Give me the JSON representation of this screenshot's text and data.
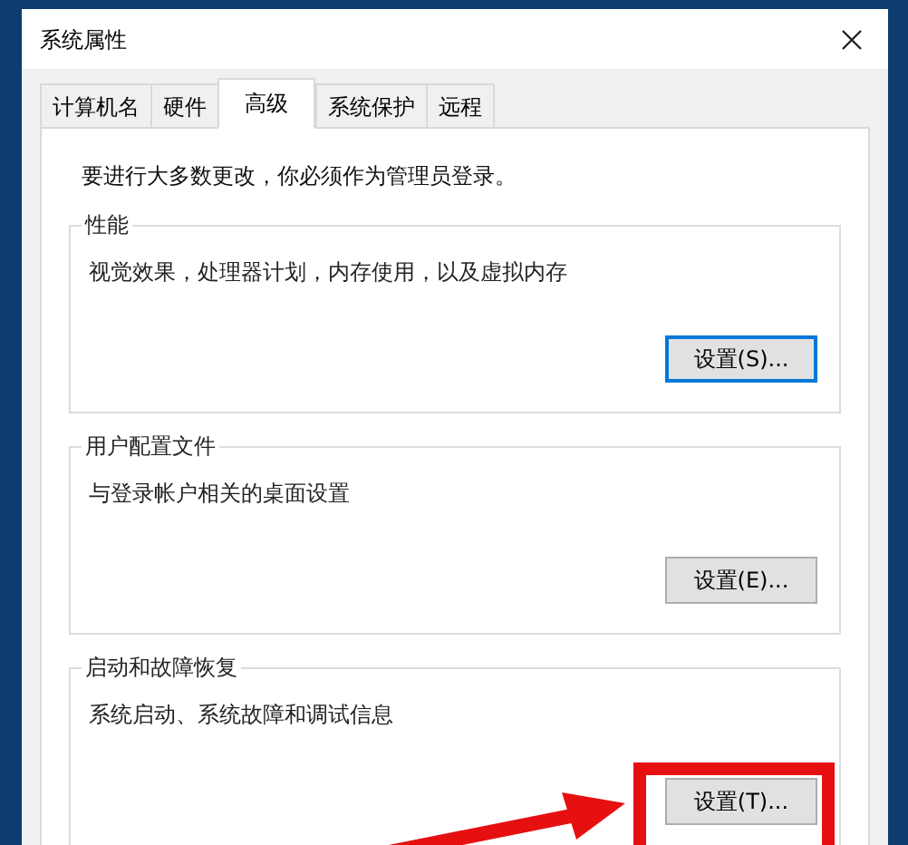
{
  "window": {
    "title": "系统属性"
  },
  "tabs": [
    {
      "label": "计算机名",
      "selected": false
    },
    {
      "label": "硬件",
      "selected": false
    },
    {
      "label": "高级",
      "selected": true
    },
    {
      "label": "系统保护",
      "selected": false
    },
    {
      "label": "远程",
      "selected": false
    }
  ],
  "notice": "要进行大多数更改，你必须作为管理员登录。",
  "groups": [
    {
      "title": "性能",
      "description": "视觉效果，处理器计划，内存使用，以及虚拟内存",
      "button": {
        "label": "设置(S)...",
        "focused": true
      }
    },
    {
      "title": "用户配置文件",
      "description": "与登录帐户相关的桌面设置",
      "button": {
        "label": "设置(E)...",
        "focused": false
      }
    },
    {
      "title": "启动和故障恢复",
      "description": "系统启动、系统故障和调试信息",
      "button": {
        "label": "设置(T)...",
        "focused": false
      }
    }
  ]
}
